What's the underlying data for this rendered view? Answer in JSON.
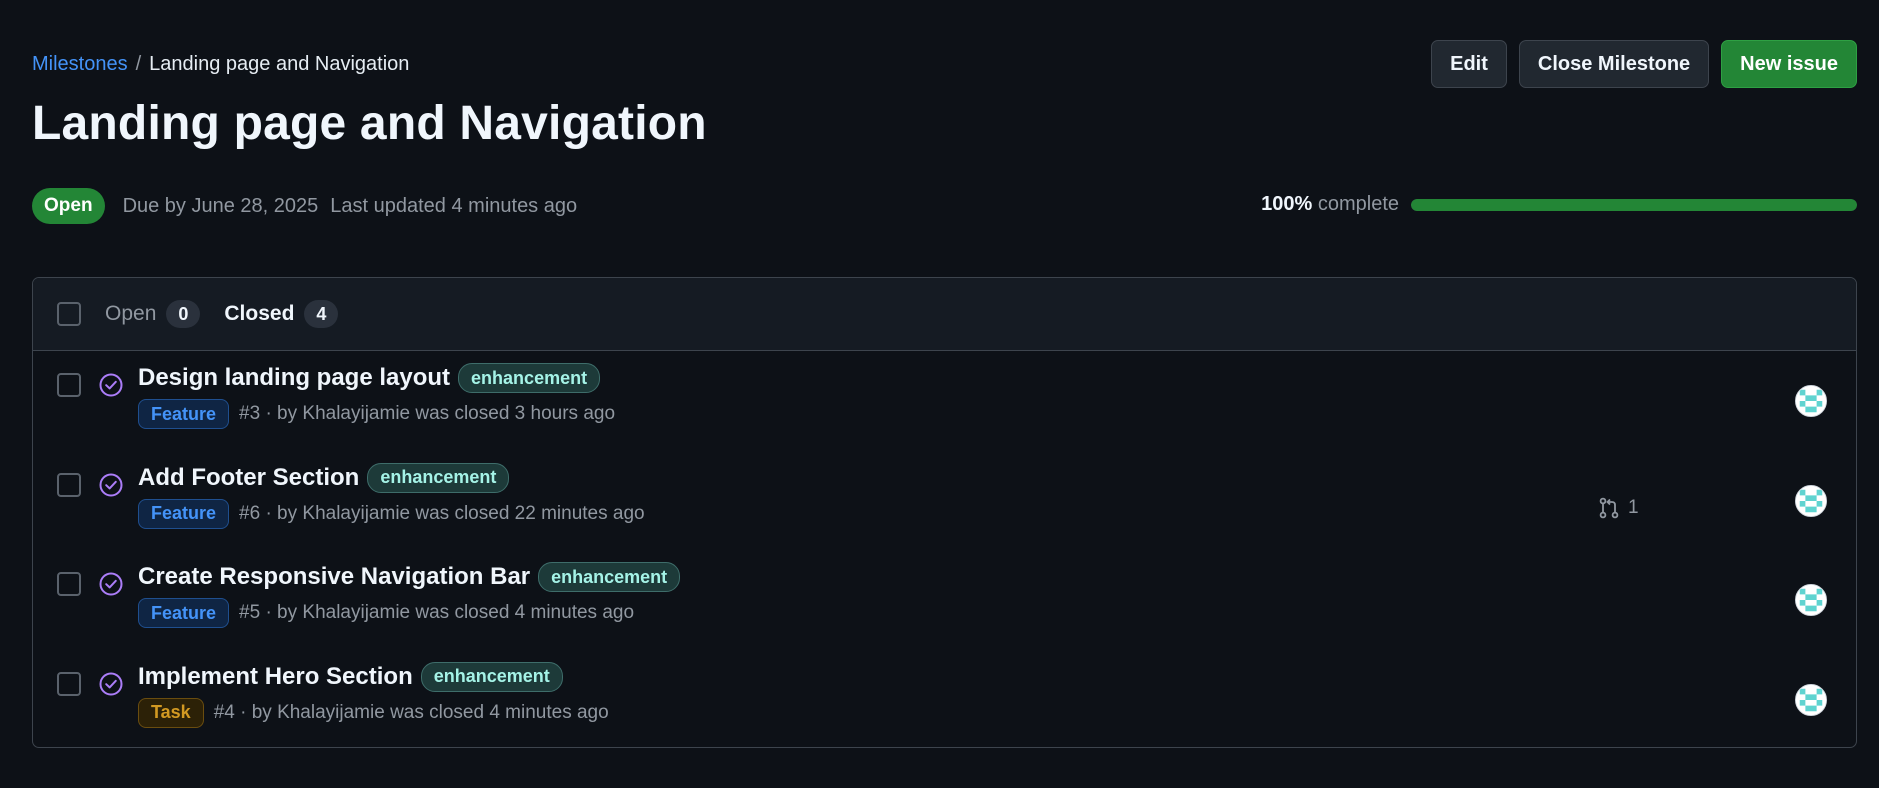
{
  "breadcrumb": {
    "link": "Milestones",
    "separator": "/",
    "current": "Landing page and Navigation"
  },
  "actions": {
    "edit": "Edit",
    "close_milestone": "Close Milestone",
    "new_issue": "New issue"
  },
  "milestone": {
    "title": "Landing page and Navigation",
    "status": "Open",
    "due": "Due by June 28, 2025",
    "updated": "Last updated 4 minutes ago",
    "progress_pct_text": "100%",
    "progress_label": "complete",
    "progress_fraction": 1.0
  },
  "filters": {
    "open_label": "Open",
    "open_count": "0",
    "closed_label": "Closed",
    "closed_count": "4"
  },
  "issues": [
    {
      "title": "Design landing page layout",
      "label": "enhancement",
      "type": "Feature",
      "meta": "#3 · by Khalayijamie was closed 3 hours ago"
    },
    {
      "title": "Add Footer Section",
      "label": "enhancement",
      "type": "Feature",
      "meta": "#6 · by Khalayijamie was closed 22 minutes ago",
      "linked_prs": "1"
    },
    {
      "title": "Create Responsive Navigation Bar",
      "label": "enhancement",
      "type": "Feature",
      "meta": "#5 · by Khalayijamie was closed 4 minutes ago"
    },
    {
      "title": "Implement Hero Section",
      "label": "enhancement",
      "type": "Task",
      "meta": "#4 · by Khalayijamie was closed 4 minutes ago"
    }
  ],
  "colors": {
    "background": "#0d1117",
    "accent_green": "#238636",
    "link_blue": "#4493f8",
    "closed_purple": "#ab7df8"
  },
  "icons": {
    "closed_issue": "issue-closed-icon",
    "pull_request": "git-pull-request-icon",
    "avatar": "identicon-avatar"
  }
}
